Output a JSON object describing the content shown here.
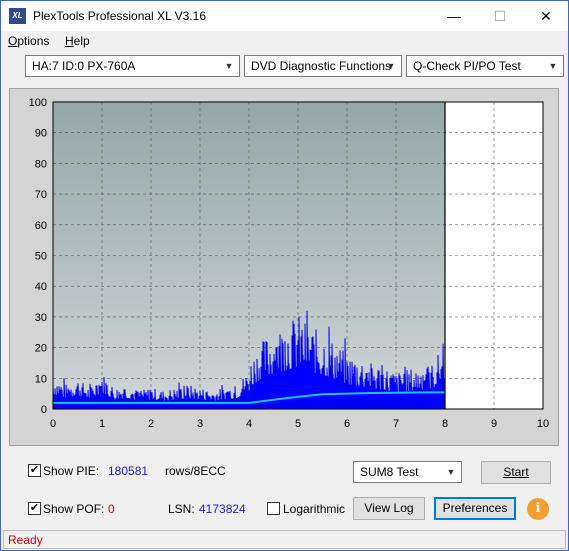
{
  "window": {
    "title": "PlexTools Professional XL V3.16",
    "icon_text": "XL",
    "min_glyph": "—",
    "max_glyph": "☐",
    "close_glyph": "✕"
  },
  "menu": {
    "options_u": "O",
    "options_rest": "ptions",
    "help_u": "H",
    "help_rest": "elp"
  },
  "toolbar": {
    "drive": "HA:7 ID:0  PX-760A",
    "function": "DVD Diagnostic Functions",
    "test": "Q-Check PI/PO Test"
  },
  "panel": {
    "show_pie_label": "Show PIE:",
    "show_pie_checked": true,
    "pie_value": "180581",
    "rows_label": "rows/8ECC",
    "show_pof_label": "Show POF:",
    "show_pof_checked": true,
    "pof_value": "0",
    "lsn_label": "LSN:",
    "lsn_value": "4173824",
    "logarithmic_label": "Logarithmic",
    "logarithmic_checked": false,
    "sum_select": "SUM8 Test",
    "start_label": "Start",
    "viewlog_label": "View Log",
    "preferences_label": "Preferences",
    "info_glyph": "i"
  },
  "status": {
    "text": "Ready"
  },
  "colors": {
    "plot_bg": "#9db0b2",
    "area_bg": "#d4d4d4",
    "pie_color": "#0000ff",
    "avg_color": "#20c0f0",
    "status_text": "#d00000"
  },
  "chart_data": {
    "type": "area",
    "xlim": [
      0,
      10
    ],
    "ylim": [
      0,
      100
    ],
    "x_ticks": [
      "0",
      "1",
      "2",
      "3",
      "4",
      "5",
      "6",
      "7",
      "8",
      "9",
      "10"
    ],
    "y_ticks": [
      "0",
      "10",
      "20",
      "30",
      "40",
      "50",
      "60",
      "70",
      "80",
      "90",
      "100"
    ],
    "grid": true,
    "scanned_until": 8.0,
    "series": [
      {
        "x": [
          0,
          0.25,
          0.5,
          0.75,
          1,
          1.25,
          1.5,
          1.75,
          2,
          2.25,
          2.5,
          2.75,
          3,
          3.25,
          3.5,
          3.75,
          4.0,
          4.05,
          4.25,
          4.5,
          4.75,
          5.0,
          5.25,
          5.5,
          5.75,
          6.0,
          6.25,
          6.5,
          6.75,
          7.0,
          7.25,
          7.5,
          7.75,
          8.0
        ],
        "values": [
          11,
          8,
          10,
          7,
          12,
          7,
          8,
          6,
          7,
          6,
          7,
          8,
          7,
          6,
          7,
          8,
          13,
          17,
          22,
          26,
          28,
          31,
          27,
          25,
          22,
          18,
          17,
          15,
          14,
          12,
          13,
          14,
          15,
          22
        ]
      },
      {
        "x": [
          0,
          0.5,
          1,
          1.5,
          2,
          2.5,
          3,
          3.5,
          4.0,
          4.5,
          5.0,
          5.5,
          6.0,
          6.5,
          7.0,
          7.5,
          8.0
        ],
        "values": [
          2,
          2,
          2,
          2,
          2,
          2,
          2,
          2,
          2,
          3,
          4,
          4.8,
          5,
          5.2,
          5.3,
          5.4,
          5.4
        ]
      }
    ]
  }
}
